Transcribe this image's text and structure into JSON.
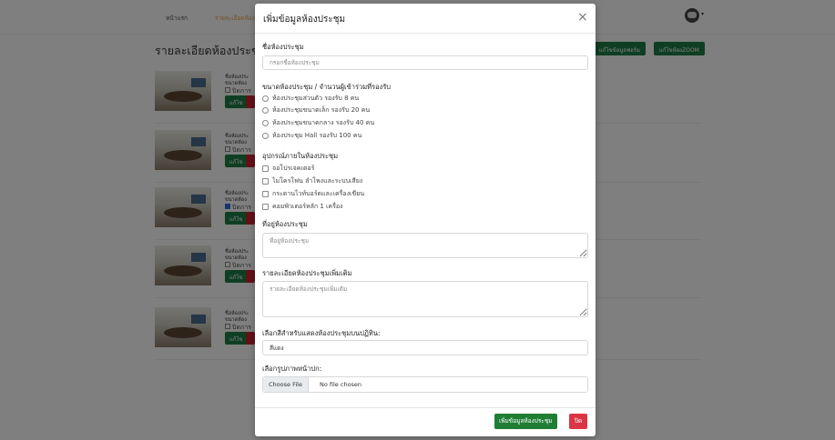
{
  "nav": {
    "home": "หน้าแรก",
    "details": "รายละเอียดห้อง"
  },
  "background": {
    "title": "รายละเอียดห้องประชุ",
    "btn_add_form": "แก้ไขข้อมูลฟอร์ม",
    "btn_edit_zoom": "แก้ไขห้องZOOM",
    "rooms": [
      {
        "name_label": "ชื่อห้องประ",
        "size_label": "ขนาดห้อง",
        "check_label": "ปิดการ",
        "checked": false,
        "edit": "แก้ไข"
      },
      {
        "name_label": "ชื่อห้องประ",
        "size_label": "ขนาดห้อง",
        "check_label": "ปิดการ",
        "checked": false,
        "edit": "แก้ไข"
      },
      {
        "name_label": "ชื่อห้องประ",
        "size_label": "ขนาดห้อง",
        "check_label": "ปิดการ",
        "checked": true,
        "edit": "แก้ไข"
      },
      {
        "name_label": "ชื่อห้องประ",
        "size_label": "ขนาดห้อง",
        "check_label": "ปิดการ",
        "checked": false,
        "edit": "แก้ไข"
      },
      {
        "name_label": "ชื่อห้องประ",
        "size_label": "ขนาดห้อง",
        "check_label": "ปิดการ",
        "checked": false,
        "edit": "แก้ไข"
      }
    ]
  },
  "modal": {
    "title": "เพิ่มข้อมูลห้องประชุม",
    "close_symbol": "×",
    "room_name_label": "ชื่อห้องประชุม",
    "room_name_placeholder": "กรอกชื่อห้องประชุม",
    "size_label": "ขนาดห้องประชุม / จำนวนผู้เข้าร่วมที่รองรับ",
    "size_options": [
      "ห้องประชุมส่วนตัว รองรับ 8 คน",
      "ห้องประชุมขนาดเล็ก รองรับ 20 คน",
      "ห้องประชุมขนาดกลาง รองรับ 40 คน",
      "ห้องประชุม Hall รองรับ 100 คน"
    ],
    "equipment_label": "อุปกรณ์ภายในห้องประชุม",
    "equipment_options": [
      "จอโปรเจคเตอร์",
      "ไมโครโฟน ลำโพงและระบบเสียง",
      "กระดานไวท์บอร์ดและเครื่องเขียน",
      "คอมพิวเตอร์หลัก 1 เครื่อง"
    ],
    "location_label": "ที่อยู่ห้องประชุม",
    "location_placeholder": "ที่อยู่ห้องประชุม",
    "extra_label": "รายละเอียดห้องประชุมเพิ่มเติม",
    "extra_placeholder": "รายละเอียดห้องประชุมเพิ่มเติม",
    "color_label": "เลือกสีสำหรับแสดงห้องประชุมบนปฏิทิน:",
    "color_value": "สีแดง",
    "image_label": "เลือกรูปภาพหน้าปก:",
    "file_button": "Choose File",
    "file_status": "No file chosen",
    "submit": "เพิ่มข้อมูลห้องประชุม",
    "close": "ปิด"
  }
}
